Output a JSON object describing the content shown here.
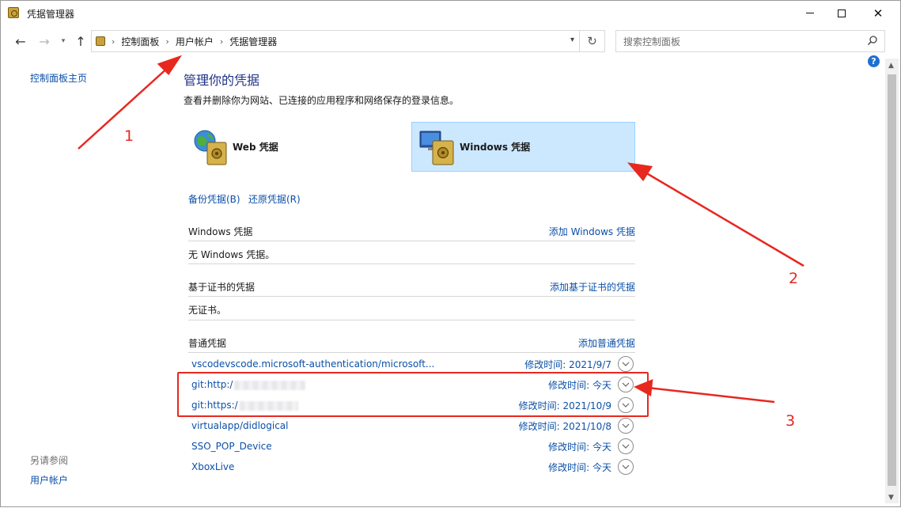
{
  "window": {
    "title": "凭据管理器"
  },
  "navbar": {
    "breadcrumbs": [
      "控制面板",
      "用户帐户",
      "凭据管理器"
    ],
    "search_placeholder": "搜索控制面板"
  },
  "sidebar": {
    "home_link": "控制面板主页",
    "see_also_label": "另请参阅",
    "see_also_link": "用户帐户"
  },
  "main": {
    "title": "管理你的凭据",
    "description": "查看并删除你为网站、已连接的应用程序和网络保存的登录信息。",
    "cred_types": [
      {
        "label": "Web 凭据",
        "icon": "web-vault-icon"
      },
      {
        "label": "Windows 凭据",
        "icon": "windows-vault-icon",
        "selected": true
      }
    ],
    "backup_link": "备份凭据(B)",
    "restore_link": "还原凭据(R)",
    "windows_section": {
      "heading": "Windows 凭据",
      "add_link": "添加 Windows 凭据",
      "empty_text": "无 Windows 凭据。"
    },
    "cert_section": {
      "heading": "基于证书的凭据",
      "add_link": "添加基于证书的凭据",
      "empty_text": "无证书。"
    },
    "generic_section": {
      "heading": "普通凭据",
      "add_link": "添加普通凭据",
      "items": [
        {
          "name": "vscodevscode.microsoft-authentication/microsoft...",
          "modified": "修改时间:  2021/9/7"
        },
        {
          "name": "git:http:/",
          "modified": "修改时间:  今天",
          "redacted": true
        },
        {
          "name": "git:https:/",
          "modified": "修改时间:  2021/10/9",
          "redacted": true
        },
        {
          "name": "virtualapp/didlogical",
          "modified": "修改时间:  2021/10/8"
        },
        {
          "name": "SSO_POP_Device",
          "modified": "修改时间:  今天"
        },
        {
          "name": "XboxLive",
          "modified": "修改时间:  今天"
        }
      ]
    }
  },
  "annotations": {
    "labels": [
      "1",
      "2",
      "3"
    ],
    "color": "#e8281f"
  },
  "colors": {
    "link": "#0b50a8",
    "title": "#1e3287",
    "selected_bg": "#cce8ff"
  }
}
